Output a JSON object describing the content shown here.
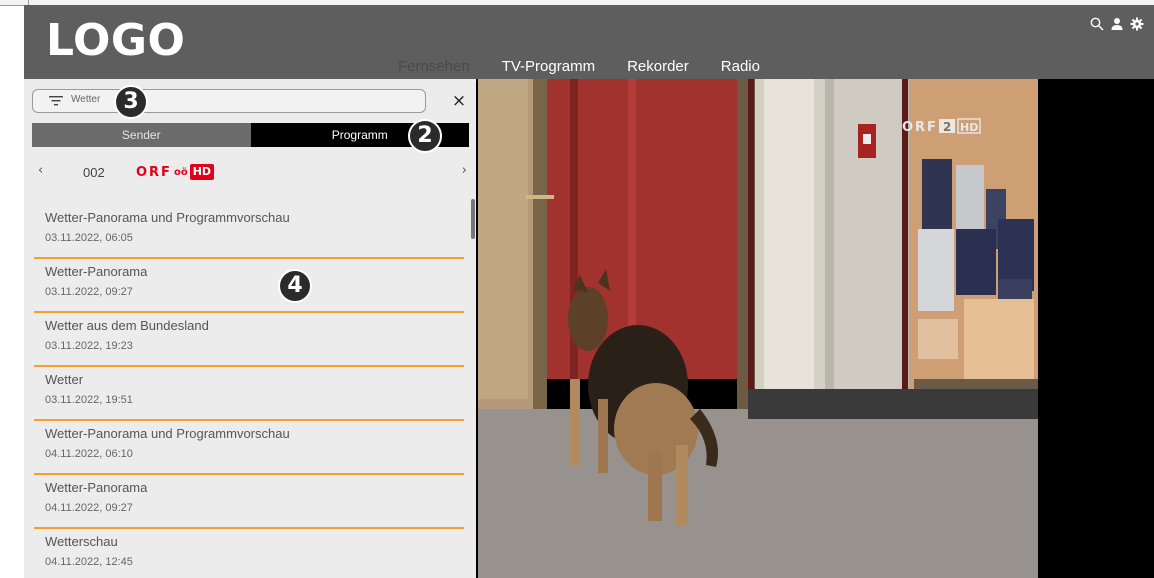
{
  "app": {
    "logo": "LOGO"
  },
  "nav": {
    "items": [
      {
        "label": "Fernsehen",
        "active": true
      },
      {
        "label": "TV-Programm",
        "active": false
      },
      {
        "label": "Rekorder",
        "active": false
      },
      {
        "label": "Radio",
        "active": false
      }
    ]
  },
  "header_icons": [
    "search-icon",
    "user-icon",
    "gear-icon"
  ],
  "search": {
    "value": "Wetter",
    "clear_label": "×"
  },
  "toggle": {
    "sender_label": "Sender",
    "programm_label": "Programm",
    "active": "Programm"
  },
  "channel": {
    "prev": "‹",
    "next": "›",
    "number": "002",
    "logo_text": "ORF",
    "logo_region": "oö",
    "logo_hd": "HD"
  },
  "results": [
    {
      "title": "Wetter-Panorama und Programmvorschau",
      "time": "03.11.2022, 06:05"
    },
    {
      "title": "Wetter-Panorama",
      "time": "03.11.2022, 09:27"
    },
    {
      "title": "Wetter aus dem Bundesland",
      "time": "03.11.2022, 19:23"
    },
    {
      "title": "Wetter",
      "time": "03.11.2022, 19:51"
    },
    {
      "title": "Wetter-Panorama und Programmvorschau",
      "time": "04.11.2022, 06:10"
    },
    {
      "title": "Wetter-Panorama",
      "time": "04.11.2022, 09:27"
    },
    {
      "title": "Wetterschau",
      "time": "04.11.2022, 12:45"
    }
  ],
  "badges": {
    "b2": "2",
    "b3": "3",
    "b4": "4"
  },
  "video": {
    "watermark_orf": "ORF",
    "watermark_num": "2",
    "watermark_hd": "HD"
  },
  "colors": {
    "accent": "#f5a02a",
    "header": "#5e5e5e",
    "orf_red": "#e2001a"
  }
}
